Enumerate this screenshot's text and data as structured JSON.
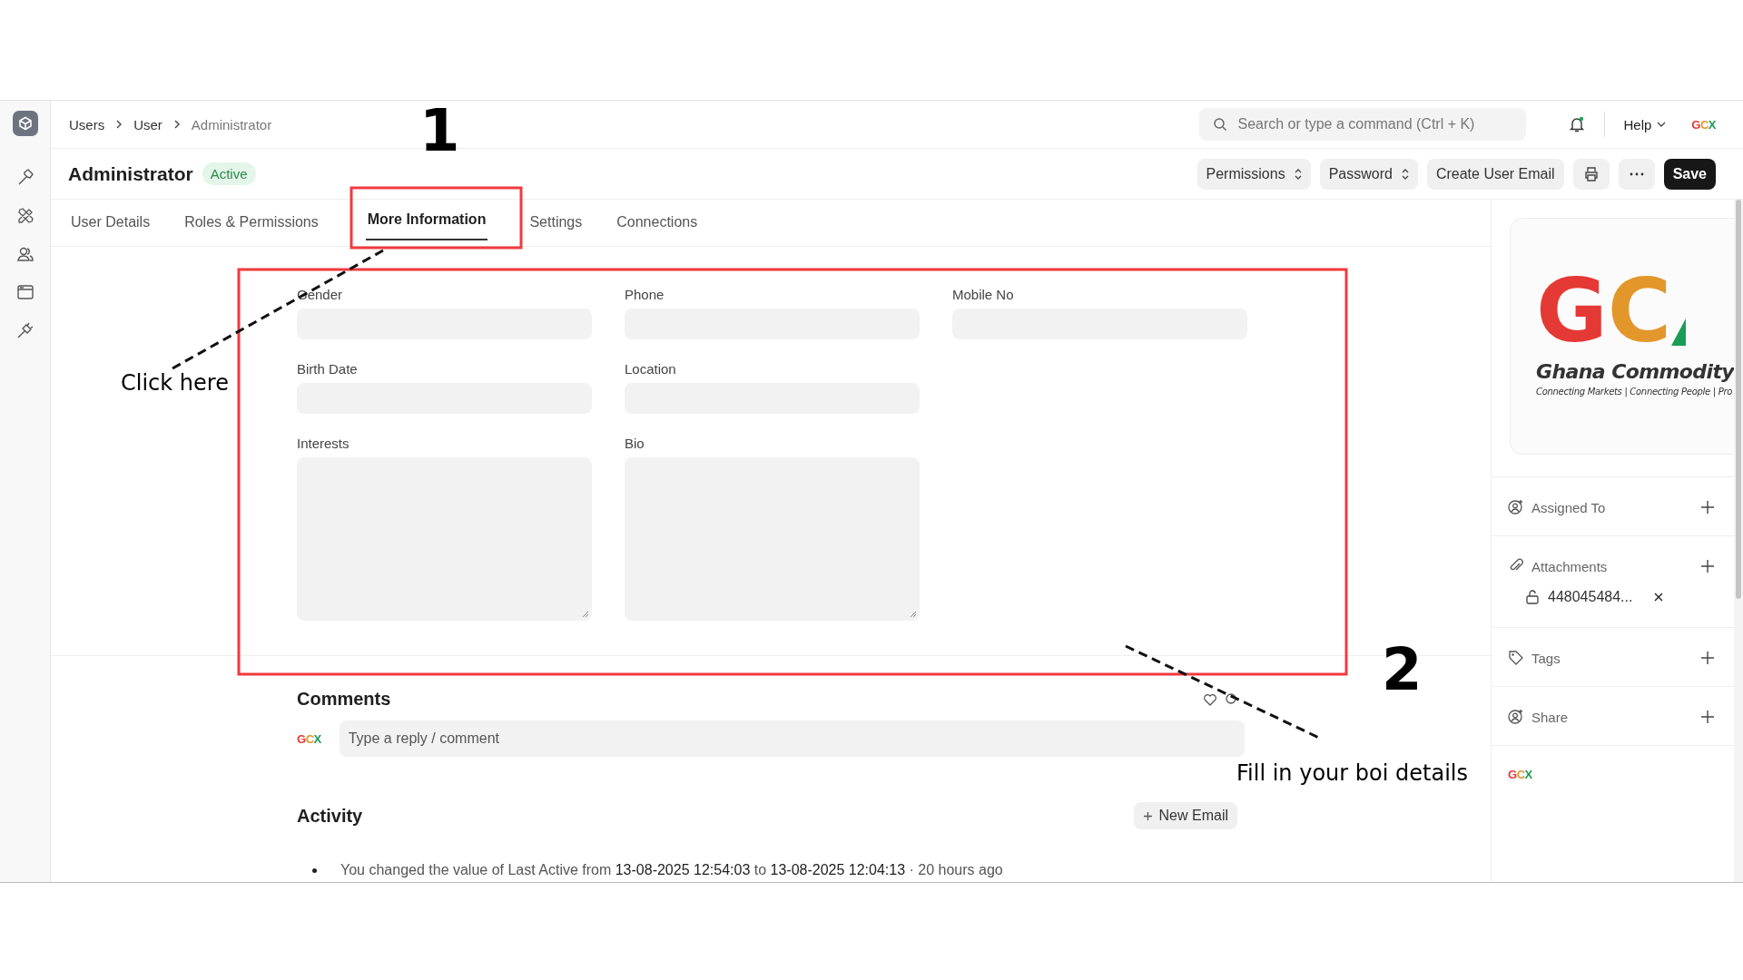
{
  "topbar": {
    "breadcrumbs": [
      "Users",
      "User",
      "Administrator"
    ],
    "search": {
      "placeholder": "Search or type a command (Ctrl + K)"
    },
    "help": "Help",
    "avatar": "GCX"
  },
  "page": {
    "title": "Administrator",
    "status": "Active"
  },
  "actions": [
    {
      "label": "Permissions",
      "kind": "dropdown"
    },
    {
      "label": "Password",
      "kind": "dropdown"
    },
    {
      "label": "Create User Email",
      "kind": "plain"
    },
    {
      "kind": "print"
    },
    {
      "kind": "more"
    },
    {
      "label": "Save",
      "kind": "primary"
    }
  ],
  "tabs": [
    {
      "label": "User Details",
      "selected": false
    },
    {
      "label": "Roles & Permissions",
      "selected": false
    },
    {
      "label": "More Information",
      "selected": true
    },
    {
      "label": "Settings",
      "selected": false
    },
    {
      "label": "Connections",
      "selected": false
    }
  ],
  "fields": [
    {
      "label": "Gender",
      "kind": "input"
    },
    {
      "label": "Phone",
      "kind": "input"
    },
    {
      "label": "Mobile No",
      "kind": "input"
    },
    {
      "label": "Birth Date",
      "kind": "input"
    },
    {
      "label": "Location",
      "kind": "input"
    },
    {
      "kind": "empty"
    },
    {
      "label": "Interests",
      "kind": "textarea"
    },
    {
      "label": "Bio",
      "kind": "textarea"
    }
  ],
  "comments": {
    "title": "Comments",
    "avatar": "GCX",
    "placeholder": "Type a reply / comment"
  },
  "activity": {
    "title": "Activity",
    "new_email": "New Email",
    "items": [
      "You changed the value of Last Active from **13-08-2025 12:54:03** to **13-08-2025 12:04:13** · 20 hours ago"
    ]
  },
  "side_panel": {
    "logo": {
      "letters": [
        {
          "char": "G",
          "color": "#e53935"
        },
        {
          "char": "C",
          "color": "#e3962a"
        }
      ],
      "name": "Ghana Commodity",
      "tagline": "Connecting Markets | Connecting People | Pro"
    },
    "sections": [
      {
        "label": "Assigned To",
        "kind": "assign"
      },
      {
        "label": "Attachments",
        "kind": "attach",
        "files": [
          "448045484..."
        ]
      },
      {
        "label": "Tags",
        "kind": "tag"
      },
      {
        "label": "Share",
        "kind": "share"
      }
    ],
    "avatar": "GCX"
  },
  "annotations": {
    "markers": [
      "1",
      "2"
    ],
    "notes": [
      "Click here",
      "Fill in your boi details"
    ]
  }
}
